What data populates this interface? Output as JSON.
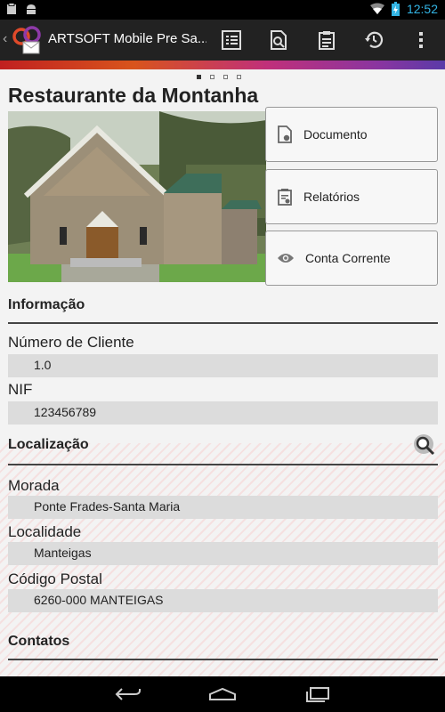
{
  "status_bar": {
    "time": "12:52",
    "icons": [
      "clipboard-icon",
      "android-icon",
      "wifi-icon",
      "battery-charging-icon",
      "signal-icon"
    ]
  },
  "action_bar": {
    "title": "ARTSOFT Mobile Pre Sa...",
    "actions": [
      "list-icon",
      "document-search-icon",
      "clipboard-report-icon",
      "history-icon",
      "overflow-menu-icon"
    ],
    "accent_gradient": [
      "#c02020",
      "#d8541c",
      "#c0307a",
      "#8a35a0",
      "#5a3aa8"
    ]
  },
  "pager": {
    "pages": 4,
    "active": 1
  },
  "page_title": "Restaurante da Montanha",
  "side_buttons": [
    {
      "label": "Documento",
      "icon": "document-icon"
    },
    {
      "label": "Relatórios",
      "icon": "report-icon"
    },
    {
      "label": "Conta Corrente",
      "icon": "eye-icon"
    }
  ],
  "sections": {
    "informacao": {
      "title": "Informação",
      "fields": [
        {
          "label": "Número de Cliente",
          "value": "1.0"
        },
        {
          "label": "NIF",
          "value": "123456789"
        }
      ]
    },
    "localizacao": {
      "title": "Localização",
      "search_icon": "map-search-icon",
      "fields": [
        {
          "label": "Morada",
          "value": "Ponte Frades-Santa Maria"
        },
        {
          "label": "Localidade",
          "value": "Manteigas"
        },
        {
          "label": "Código Postal",
          "value": "6260-000 MANTEIGAS"
        }
      ]
    },
    "contatos": {
      "title": "Contatos"
    }
  },
  "nav_bar": [
    "back-icon",
    "home-icon",
    "recent-apps-icon"
  ]
}
